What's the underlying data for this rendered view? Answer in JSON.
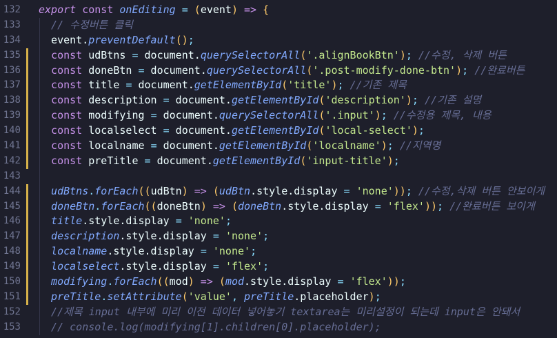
{
  "editor": {
    "change_bar_color": "#d7b24a",
    "lines": [
      {
        "num": "132",
        "changed": false,
        "tokens": [
          {
            "t": "export",
            "c": "tok-keyword tok-italic"
          },
          {
            "t": " ",
            "c": "tok-plain"
          },
          {
            "t": "const",
            "c": "tok-keyword"
          },
          {
            "t": " ",
            "c": "tok-plain"
          },
          {
            "t": "onEditing",
            "c": "tok-func"
          },
          {
            "t": " = ",
            "c": "tok-punct"
          },
          {
            "t": "(",
            "c": "tok-yellow"
          },
          {
            "t": "event",
            "c": "tok-plain"
          },
          {
            "t": ")",
            "c": "tok-yellow"
          },
          {
            "t": " => ",
            "c": "tok-keyword"
          },
          {
            "t": "{",
            "c": "tok-yellow"
          }
        ]
      },
      {
        "num": "133",
        "changed": false,
        "tokens": [
          {
            "t": "  // 수정버튼 클릭",
            "c": "tok-comment"
          }
        ]
      },
      {
        "num": "134",
        "changed": false,
        "tokens": [
          {
            "t": "  event.",
            "c": "tok-plain"
          },
          {
            "t": "preventDefault",
            "c": "tok-func"
          },
          {
            "t": "()",
            "c": "tok-yellow"
          },
          {
            "t": ";",
            "c": "tok-punct"
          }
        ]
      },
      {
        "num": "135",
        "changed": true,
        "tokens": [
          {
            "t": "  const",
            "c": "tok-keyword"
          },
          {
            "t": " udBtns ",
            "c": "tok-plain"
          },
          {
            "t": "=",
            "c": "tok-punct"
          },
          {
            "t": " document.",
            "c": "tok-plain"
          },
          {
            "t": "querySelectorAll",
            "c": "tok-func"
          },
          {
            "t": "(",
            "c": "tok-yellow"
          },
          {
            "t": "'.alignBookBtn'",
            "c": "tok-string"
          },
          {
            "t": ")",
            "c": "tok-yellow"
          },
          {
            "t": "; ",
            "c": "tok-punct"
          },
          {
            "t": "//수정, 삭제 버튼",
            "c": "tok-comment"
          }
        ]
      },
      {
        "num": "136",
        "changed": true,
        "tokens": [
          {
            "t": "  const",
            "c": "tok-keyword"
          },
          {
            "t": " doneBtn ",
            "c": "tok-plain"
          },
          {
            "t": "=",
            "c": "tok-punct"
          },
          {
            "t": " document.",
            "c": "tok-plain"
          },
          {
            "t": "querySelectorAll",
            "c": "tok-func"
          },
          {
            "t": "(",
            "c": "tok-yellow"
          },
          {
            "t": "'.post-modify-done-btn'",
            "c": "tok-string"
          },
          {
            "t": ")",
            "c": "tok-yellow"
          },
          {
            "t": "; ",
            "c": "tok-punct"
          },
          {
            "t": "//완료버튼",
            "c": "tok-comment"
          }
        ]
      },
      {
        "num": "137",
        "changed": true,
        "tokens": [
          {
            "t": "  const",
            "c": "tok-keyword"
          },
          {
            "t": " title ",
            "c": "tok-plain"
          },
          {
            "t": "=",
            "c": "tok-punct"
          },
          {
            "t": " document.",
            "c": "tok-plain"
          },
          {
            "t": "getElementById",
            "c": "tok-func"
          },
          {
            "t": "(",
            "c": "tok-yellow"
          },
          {
            "t": "'title'",
            "c": "tok-string"
          },
          {
            "t": ")",
            "c": "tok-yellow"
          },
          {
            "t": "; ",
            "c": "tok-punct"
          },
          {
            "t": "//기존 제목",
            "c": "tok-comment"
          }
        ]
      },
      {
        "num": "138",
        "changed": true,
        "tokens": [
          {
            "t": "  const",
            "c": "tok-keyword"
          },
          {
            "t": " description ",
            "c": "tok-plain"
          },
          {
            "t": "=",
            "c": "tok-punct"
          },
          {
            "t": " document.",
            "c": "tok-plain"
          },
          {
            "t": "getElementById",
            "c": "tok-func"
          },
          {
            "t": "(",
            "c": "tok-yellow"
          },
          {
            "t": "'description'",
            "c": "tok-string"
          },
          {
            "t": ")",
            "c": "tok-yellow"
          },
          {
            "t": "; ",
            "c": "tok-punct"
          },
          {
            "t": "//기존 설명",
            "c": "tok-comment"
          }
        ]
      },
      {
        "num": "139",
        "changed": true,
        "tokens": [
          {
            "t": "  const",
            "c": "tok-keyword"
          },
          {
            "t": " modifying ",
            "c": "tok-plain"
          },
          {
            "t": "=",
            "c": "tok-punct"
          },
          {
            "t": " document.",
            "c": "tok-plain"
          },
          {
            "t": "querySelectorAll",
            "c": "tok-func"
          },
          {
            "t": "(",
            "c": "tok-yellow"
          },
          {
            "t": "'.input'",
            "c": "tok-string"
          },
          {
            "t": ")",
            "c": "tok-yellow"
          },
          {
            "t": "; ",
            "c": "tok-punct"
          },
          {
            "t": "//수정용 제목, 내용",
            "c": "tok-comment"
          }
        ]
      },
      {
        "num": "140",
        "changed": true,
        "tokens": [
          {
            "t": "  const",
            "c": "tok-keyword"
          },
          {
            "t": " localselect ",
            "c": "tok-plain"
          },
          {
            "t": "=",
            "c": "tok-punct"
          },
          {
            "t": " document.",
            "c": "tok-plain"
          },
          {
            "t": "getElementById",
            "c": "tok-func"
          },
          {
            "t": "(",
            "c": "tok-yellow"
          },
          {
            "t": "'local-select'",
            "c": "tok-string"
          },
          {
            "t": ")",
            "c": "tok-yellow"
          },
          {
            "t": ";",
            "c": "tok-punct"
          }
        ]
      },
      {
        "num": "141",
        "changed": true,
        "tokens": [
          {
            "t": "  const",
            "c": "tok-keyword"
          },
          {
            "t": " localname ",
            "c": "tok-plain"
          },
          {
            "t": "=",
            "c": "tok-punct"
          },
          {
            "t": " document.",
            "c": "tok-plain"
          },
          {
            "t": "getElementById",
            "c": "tok-func"
          },
          {
            "t": "(",
            "c": "tok-yellow"
          },
          {
            "t": "'localname'",
            "c": "tok-string"
          },
          {
            "t": ")",
            "c": "tok-yellow"
          },
          {
            "t": "; ",
            "c": "tok-punct"
          },
          {
            "t": "//지역명",
            "c": "tok-comment"
          }
        ]
      },
      {
        "num": "142",
        "changed": true,
        "tokens": [
          {
            "t": "  const",
            "c": "tok-keyword"
          },
          {
            "t": " preTitle ",
            "c": "tok-plain"
          },
          {
            "t": "=",
            "c": "tok-punct"
          },
          {
            "t": " document.",
            "c": "tok-plain"
          },
          {
            "t": "getElementById",
            "c": "tok-func"
          },
          {
            "t": "(",
            "c": "tok-yellow"
          },
          {
            "t": "'input-title'",
            "c": "tok-string"
          },
          {
            "t": ")",
            "c": "tok-yellow"
          },
          {
            "t": ";",
            "c": "tok-punct"
          }
        ]
      },
      {
        "num": "143",
        "changed": false,
        "tokens": []
      },
      {
        "num": "144",
        "changed": true,
        "tokens": [
          {
            "t": "  udBtns",
            "c": "tok-var-italic"
          },
          {
            "t": ".",
            "c": "tok-punct"
          },
          {
            "t": "forEach",
            "c": "tok-func"
          },
          {
            "t": "((",
            "c": "tok-yellow"
          },
          {
            "t": "udBtn",
            "c": "tok-plain"
          },
          {
            "t": ")",
            "c": "tok-yellow"
          },
          {
            "t": " => ",
            "c": "tok-keyword"
          },
          {
            "t": "(",
            "c": "tok-yellow"
          },
          {
            "t": "udBtn",
            "c": "tok-var-italic"
          },
          {
            "t": ".style.display ",
            "c": "tok-plain"
          },
          {
            "t": "=",
            "c": "tok-punct"
          },
          {
            "t": " ",
            "c": "tok-plain"
          },
          {
            "t": "'none'",
            "c": "tok-string"
          },
          {
            "t": "))",
            "c": "tok-yellow"
          },
          {
            "t": "; ",
            "c": "tok-punct"
          },
          {
            "t": "//수정,삭제 버튼 안보이게",
            "c": "tok-comment"
          }
        ]
      },
      {
        "num": "145",
        "changed": true,
        "tokens": [
          {
            "t": "  doneBtn",
            "c": "tok-var-italic"
          },
          {
            "t": ".",
            "c": "tok-punct"
          },
          {
            "t": "forEach",
            "c": "tok-func"
          },
          {
            "t": "((",
            "c": "tok-yellow"
          },
          {
            "t": "doneBtn",
            "c": "tok-plain"
          },
          {
            "t": ")",
            "c": "tok-yellow"
          },
          {
            "t": " => ",
            "c": "tok-keyword"
          },
          {
            "t": "(",
            "c": "tok-yellow"
          },
          {
            "t": "doneBtn",
            "c": "tok-var-italic"
          },
          {
            "t": ".style.display ",
            "c": "tok-plain"
          },
          {
            "t": "=",
            "c": "tok-punct"
          },
          {
            "t": " ",
            "c": "tok-plain"
          },
          {
            "t": "'flex'",
            "c": "tok-string"
          },
          {
            "t": "))",
            "c": "tok-yellow"
          },
          {
            "t": "; ",
            "c": "tok-punct"
          },
          {
            "t": "//완료버튼 보이게",
            "c": "tok-comment"
          }
        ]
      },
      {
        "num": "146",
        "changed": true,
        "tokens": [
          {
            "t": "  title",
            "c": "tok-var-italic"
          },
          {
            "t": ".style.display ",
            "c": "tok-plain"
          },
          {
            "t": "=",
            "c": "tok-punct"
          },
          {
            "t": " ",
            "c": "tok-plain"
          },
          {
            "t": "'none'",
            "c": "tok-string"
          },
          {
            "t": ";",
            "c": "tok-punct"
          }
        ]
      },
      {
        "num": "147",
        "changed": true,
        "tokens": [
          {
            "t": "  description",
            "c": "tok-var-italic"
          },
          {
            "t": ".style.display ",
            "c": "tok-plain"
          },
          {
            "t": "=",
            "c": "tok-punct"
          },
          {
            "t": " ",
            "c": "tok-plain"
          },
          {
            "t": "'none'",
            "c": "tok-string"
          },
          {
            "t": ";",
            "c": "tok-punct"
          }
        ]
      },
      {
        "num": "148",
        "changed": true,
        "tokens": [
          {
            "t": "  localname",
            "c": "tok-var-italic"
          },
          {
            "t": ".style.display ",
            "c": "tok-plain"
          },
          {
            "t": "=",
            "c": "tok-punct"
          },
          {
            "t": " ",
            "c": "tok-plain"
          },
          {
            "t": "'none'",
            "c": "tok-string"
          },
          {
            "t": ";",
            "c": "tok-punct"
          }
        ]
      },
      {
        "num": "149",
        "changed": true,
        "tokens": [
          {
            "t": "  localselect",
            "c": "tok-var-italic"
          },
          {
            "t": ".style.display ",
            "c": "tok-plain"
          },
          {
            "t": "=",
            "c": "tok-punct"
          },
          {
            "t": " ",
            "c": "tok-plain"
          },
          {
            "t": "'flex'",
            "c": "tok-string"
          },
          {
            "t": ";",
            "c": "tok-punct"
          }
        ]
      },
      {
        "num": "150",
        "changed": true,
        "tokens": [
          {
            "t": "  modifying",
            "c": "tok-var-italic"
          },
          {
            "t": ".",
            "c": "tok-punct"
          },
          {
            "t": "forEach",
            "c": "tok-func"
          },
          {
            "t": "((",
            "c": "tok-yellow"
          },
          {
            "t": "mod",
            "c": "tok-plain"
          },
          {
            "t": ")",
            "c": "tok-yellow"
          },
          {
            "t": " => ",
            "c": "tok-keyword"
          },
          {
            "t": "(",
            "c": "tok-yellow"
          },
          {
            "t": "mod",
            "c": "tok-var-italic"
          },
          {
            "t": ".style.display ",
            "c": "tok-plain"
          },
          {
            "t": "=",
            "c": "tok-punct"
          },
          {
            "t": " ",
            "c": "tok-plain"
          },
          {
            "t": "'flex'",
            "c": "tok-string"
          },
          {
            "t": "))",
            "c": "tok-yellow"
          },
          {
            "t": ";",
            "c": "tok-punct"
          }
        ]
      },
      {
        "num": "151",
        "changed": true,
        "tokens": [
          {
            "t": "  preTitle",
            "c": "tok-var-italic"
          },
          {
            "t": ".",
            "c": "tok-punct"
          },
          {
            "t": "setAttribute",
            "c": "tok-func"
          },
          {
            "t": "(",
            "c": "tok-yellow"
          },
          {
            "t": "'value'",
            "c": "tok-string"
          },
          {
            "t": ", ",
            "c": "tok-punct"
          },
          {
            "t": "preTitle",
            "c": "tok-var-italic"
          },
          {
            "t": ".placeholder",
            "c": "tok-plain"
          },
          {
            "t": ")",
            "c": "tok-yellow"
          },
          {
            "t": ";",
            "c": "tok-punct"
          }
        ]
      },
      {
        "num": "152",
        "changed": false,
        "tokens": [
          {
            "t": "  //제목 input 내부에 미리 이전 데이터 넣어놓기 textarea는 미리설정이 되는데 input은 안돼서",
            "c": "tok-comment"
          }
        ]
      },
      {
        "num": "153",
        "changed": false,
        "tokens": [
          {
            "t": "  // console.log(modifying[1].children[0].placeholder);",
            "c": "tok-comment"
          }
        ]
      }
    ]
  }
}
